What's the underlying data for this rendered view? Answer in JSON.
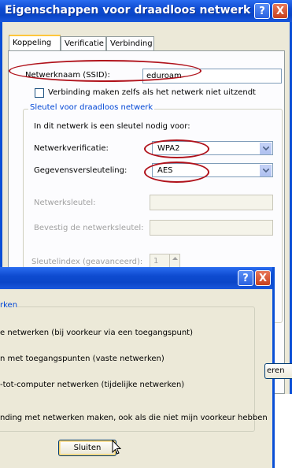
{
  "window": {
    "title": "Eigenschappen voor draadloos netwerk",
    "help_label": "?",
    "close_label": "X",
    "tabs": [
      {
        "label": "Koppeling",
        "active": true
      },
      {
        "label": "Verificatie",
        "active": false
      },
      {
        "label": "Verbinding",
        "active": false
      }
    ],
    "ssid_label": "Netwerknaam (SSID):",
    "ssid_value": "eduroam",
    "hidden_checkbox_label": "Verbinding maken zelfs als het netwerk niet uitzendt",
    "hidden_checkbox_checked": false,
    "key_group_title": "Sleutel voor draadloos netwerk",
    "key_intro": "In dit netwerk is een sleutel nodig voor:",
    "auth_label": "Netwerkverificatie:",
    "auth_value": "WPA2",
    "encryption_label": "Gegevensversleuteling:",
    "encryption_value": "AES",
    "network_key_label": "Netwerksleutel:",
    "confirm_key_label": "Bevestig de netwerksleutel:",
    "key_index_label": "Sleutelindex (geavanceerd):",
    "key_index_value": "1",
    "partial_button_label": "eren"
  },
  "dialog2": {
    "help_label": "?",
    "close_label": "X",
    "section_title": "rken",
    "options": [
      "e netwerken (bij voorkeur via een toegangspunt)",
      "n met toegangspunten (vaste netwerken)",
      "-tot-computer netwerken (tijdelijke netwerken)"
    ],
    "auto_connect_text": "nding met netwerken maken, ook als die niet mijn voorkeur hebben",
    "close_button_label": "Sluiten"
  },
  "colors": {
    "titlebar": "#0a46c8",
    "annotation": "#b0121b",
    "group_title": "#0046d5",
    "dialog_bg": "#ece9d8"
  }
}
